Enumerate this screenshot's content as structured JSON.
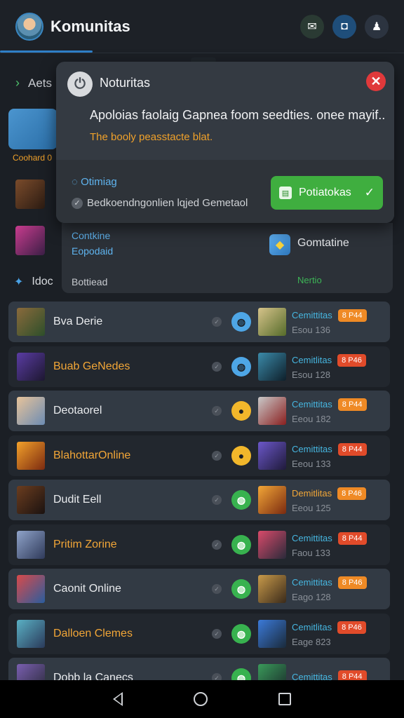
{
  "header": {
    "title": "Komunitas",
    "icons": [
      "mail-icon",
      "square-icon",
      "user-icon"
    ]
  },
  "background": {
    "section_label": "Aets",
    "card_label": "Coohard 0",
    "section2_label": "Idoc"
  },
  "popup": {
    "title": "Noturitas",
    "message": "Apoloias faolaig Gapnea foom seedties. onee mayif..",
    "subtext": "The booly peasstacte blat.",
    "timing_label": "Otimiag",
    "check_label": "Bedkoendngonlien lqjed Gemetaol",
    "action_label": "Potiatokas"
  },
  "panel2": {
    "line1": "Contkine",
    "line2": "Eopodaid",
    "line3": "Bottiead",
    "app_label": "Gomtatine",
    "status": "Nertio"
  },
  "list": [
    {
      "name": "Bva Derie",
      "name_color": "white",
      "badge_color": "blue",
      "comm": "Cemittitas",
      "price": "8 P44",
      "price_color": "orange",
      "sub": "Esou 136"
    },
    {
      "name": "Buab GeNedes",
      "name_color": "orange",
      "badge_color": "blue",
      "comm": "Cemitlitas",
      "price": "8 P46",
      "price_color": "red",
      "sub": "Esou 128"
    },
    {
      "name": "Deotaorel",
      "name_color": "white",
      "badge_color": "yellow",
      "comm": "Cemittitas",
      "price": "8 P44",
      "price_color": "orange",
      "sub": "Eeou 182"
    },
    {
      "name": "BlahottarOnline",
      "name_color": "orange",
      "badge_color": "yellow",
      "comm": "Cemittitas",
      "price": "8 P44",
      "price_color": "red",
      "sub": "Eeou 133"
    },
    {
      "name": "Dudit Eell",
      "name_color": "white",
      "badge_color": "green",
      "comm": "Demitlitas",
      "price": "8 P46",
      "price_color": "orange",
      "sub": "Eeou 125"
    },
    {
      "name": "Pritim Zorine",
      "name_color": "orange",
      "badge_color": "green",
      "comm": "Cemittitas",
      "price": "8 P44",
      "price_color": "red",
      "sub": "Faou 133"
    },
    {
      "name": "Caonit Online",
      "name_color": "white",
      "badge_color": "green",
      "comm": "Cemittitas",
      "price": "8 P46",
      "price_color": "orange",
      "sub": "Eago 128"
    },
    {
      "name": "Dalloen Clemes",
      "name_color": "orange",
      "badge_color": "green",
      "comm": "Cemitlitas",
      "price": "8 P46",
      "price_color": "red",
      "sub": "Eage 823"
    },
    {
      "name": "Dobb la Canecs",
      "name_color": "white",
      "badge_color": "green",
      "comm": "Cemittitas",
      "price": "8 P44",
      "price_color": "red",
      "sub": ""
    }
  ],
  "navbar": {
    "icons": [
      "back-icon",
      "home-icon",
      "recents-icon"
    ]
  },
  "colors": {
    "accent_blue": "#2f7fc7",
    "green_action": "#3fae3f",
    "close_red": "#e0393b",
    "orange_text": "#f2a637"
  }
}
